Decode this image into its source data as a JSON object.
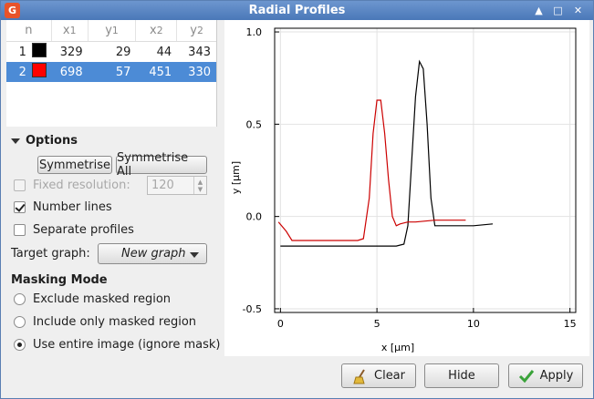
{
  "window": {
    "title": "Radial Profiles"
  },
  "table": {
    "headers": {
      "n": "n",
      "x1": "x",
      "x1_sub": "1",
      "y1": "y",
      "y1_sub": "1",
      "x2": "x",
      "x2_sub": "2",
      "y2": "y",
      "y2_sub": "2"
    },
    "rows": [
      {
        "n": "1",
        "color": "#000000",
        "x1": "329",
        "y1": "29",
        "x2": "44",
        "y2": "343"
      },
      {
        "n": "2",
        "color": "#ff0000",
        "x1": "698",
        "y1": "57",
        "x2": "451",
        "y2": "330"
      }
    ]
  },
  "options": {
    "header": "Options",
    "symmetrise": "Symmetrise",
    "symmetrise_all": "Symmetrise All",
    "fixed_resolution": "Fixed resolution:",
    "fixed_resolution_value": "120",
    "number_lines": "Number lines",
    "separate_profiles": "Separate profiles",
    "target_graph_label": "Target graph:",
    "target_graph_value": "New graph"
  },
  "masking": {
    "header": "Masking Mode",
    "exclude": "Exclude masked region",
    "include_only": "Include only masked region",
    "entire": "Use entire image (ignore mask)"
  },
  "buttons": {
    "clear": "Clear",
    "hide": "Hide",
    "apply": "Apply"
  },
  "chart_data": {
    "type": "line",
    "xlabel": "x [µm]",
    "ylabel": "y [µm]",
    "xlim": [
      -0.3,
      15.3
    ],
    "ylim": [
      -0.52,
      1.02
    ],
    "xticks": [
      "0",
      "5",
      "10",
      "15"
    ],
    "xtick_values": [
      0,
      5,
      10,
      15
    ],
    "yticks": [
      "1.0",
      "0.5",
      "0.0",
      "-0.5"
    ],
    "ytick_values": [
      1.0,
      0.5,
      0.0,
      -0.5
    ],
    "grid": true,
    "series": [
      {
        "color": "#000000",
        "x": [
          0,
          1,
          2,
          3,
          4,
          5,
          6,
          6.4,
          6.6,
          6.8,
          7.0,
          7.2,
          7.4,
          7.6,
          7.8,
          8.0,
          8.2,
          8.4,
          9,
          10,
          11
        ],
        "y": [
          -0.16,
          -0.16,
          -0.16,
          -0.16,
          -0.16,
          -0.16,
          -0.16,
          -0.15,
          -0.05,
          0.3,
          0.65,
          0.84,
          0.8,
          0.5,
          0.1,
          -0.05,
          -0.05,
          -0.05,
          -0.05,
          -0.05,
          -0.04
        ]
      },
      {
        "color": "#cc0000",
        "x": [
          -0.1,
          0.3,
          0.6,
          1,
          2,
          3,
          4,
          4.3,
          4.6,
          4.8,
          5.0,
          5.2,
          5.4,
          5.6,
          5.8,
          6.0,
          6.2,
          6.6,
          7,
          8,
          9,
          9.6
        ],
        "y": [
          -0.03,
          -0.08,
          -0.13,
          -0.13,
          -0.13,
          -0.13,
          -0.13,
          -0.12,
          0.1,
          0.45,
          0.63,
          0.63,
          0.45,
          0.2,
          0.0,
          -0.05,
          -0.04,
          -0.03,
          -0.03,
          -0.02,
          -0.02,
          -0.02
        ]
      }
    ]
  }
}
